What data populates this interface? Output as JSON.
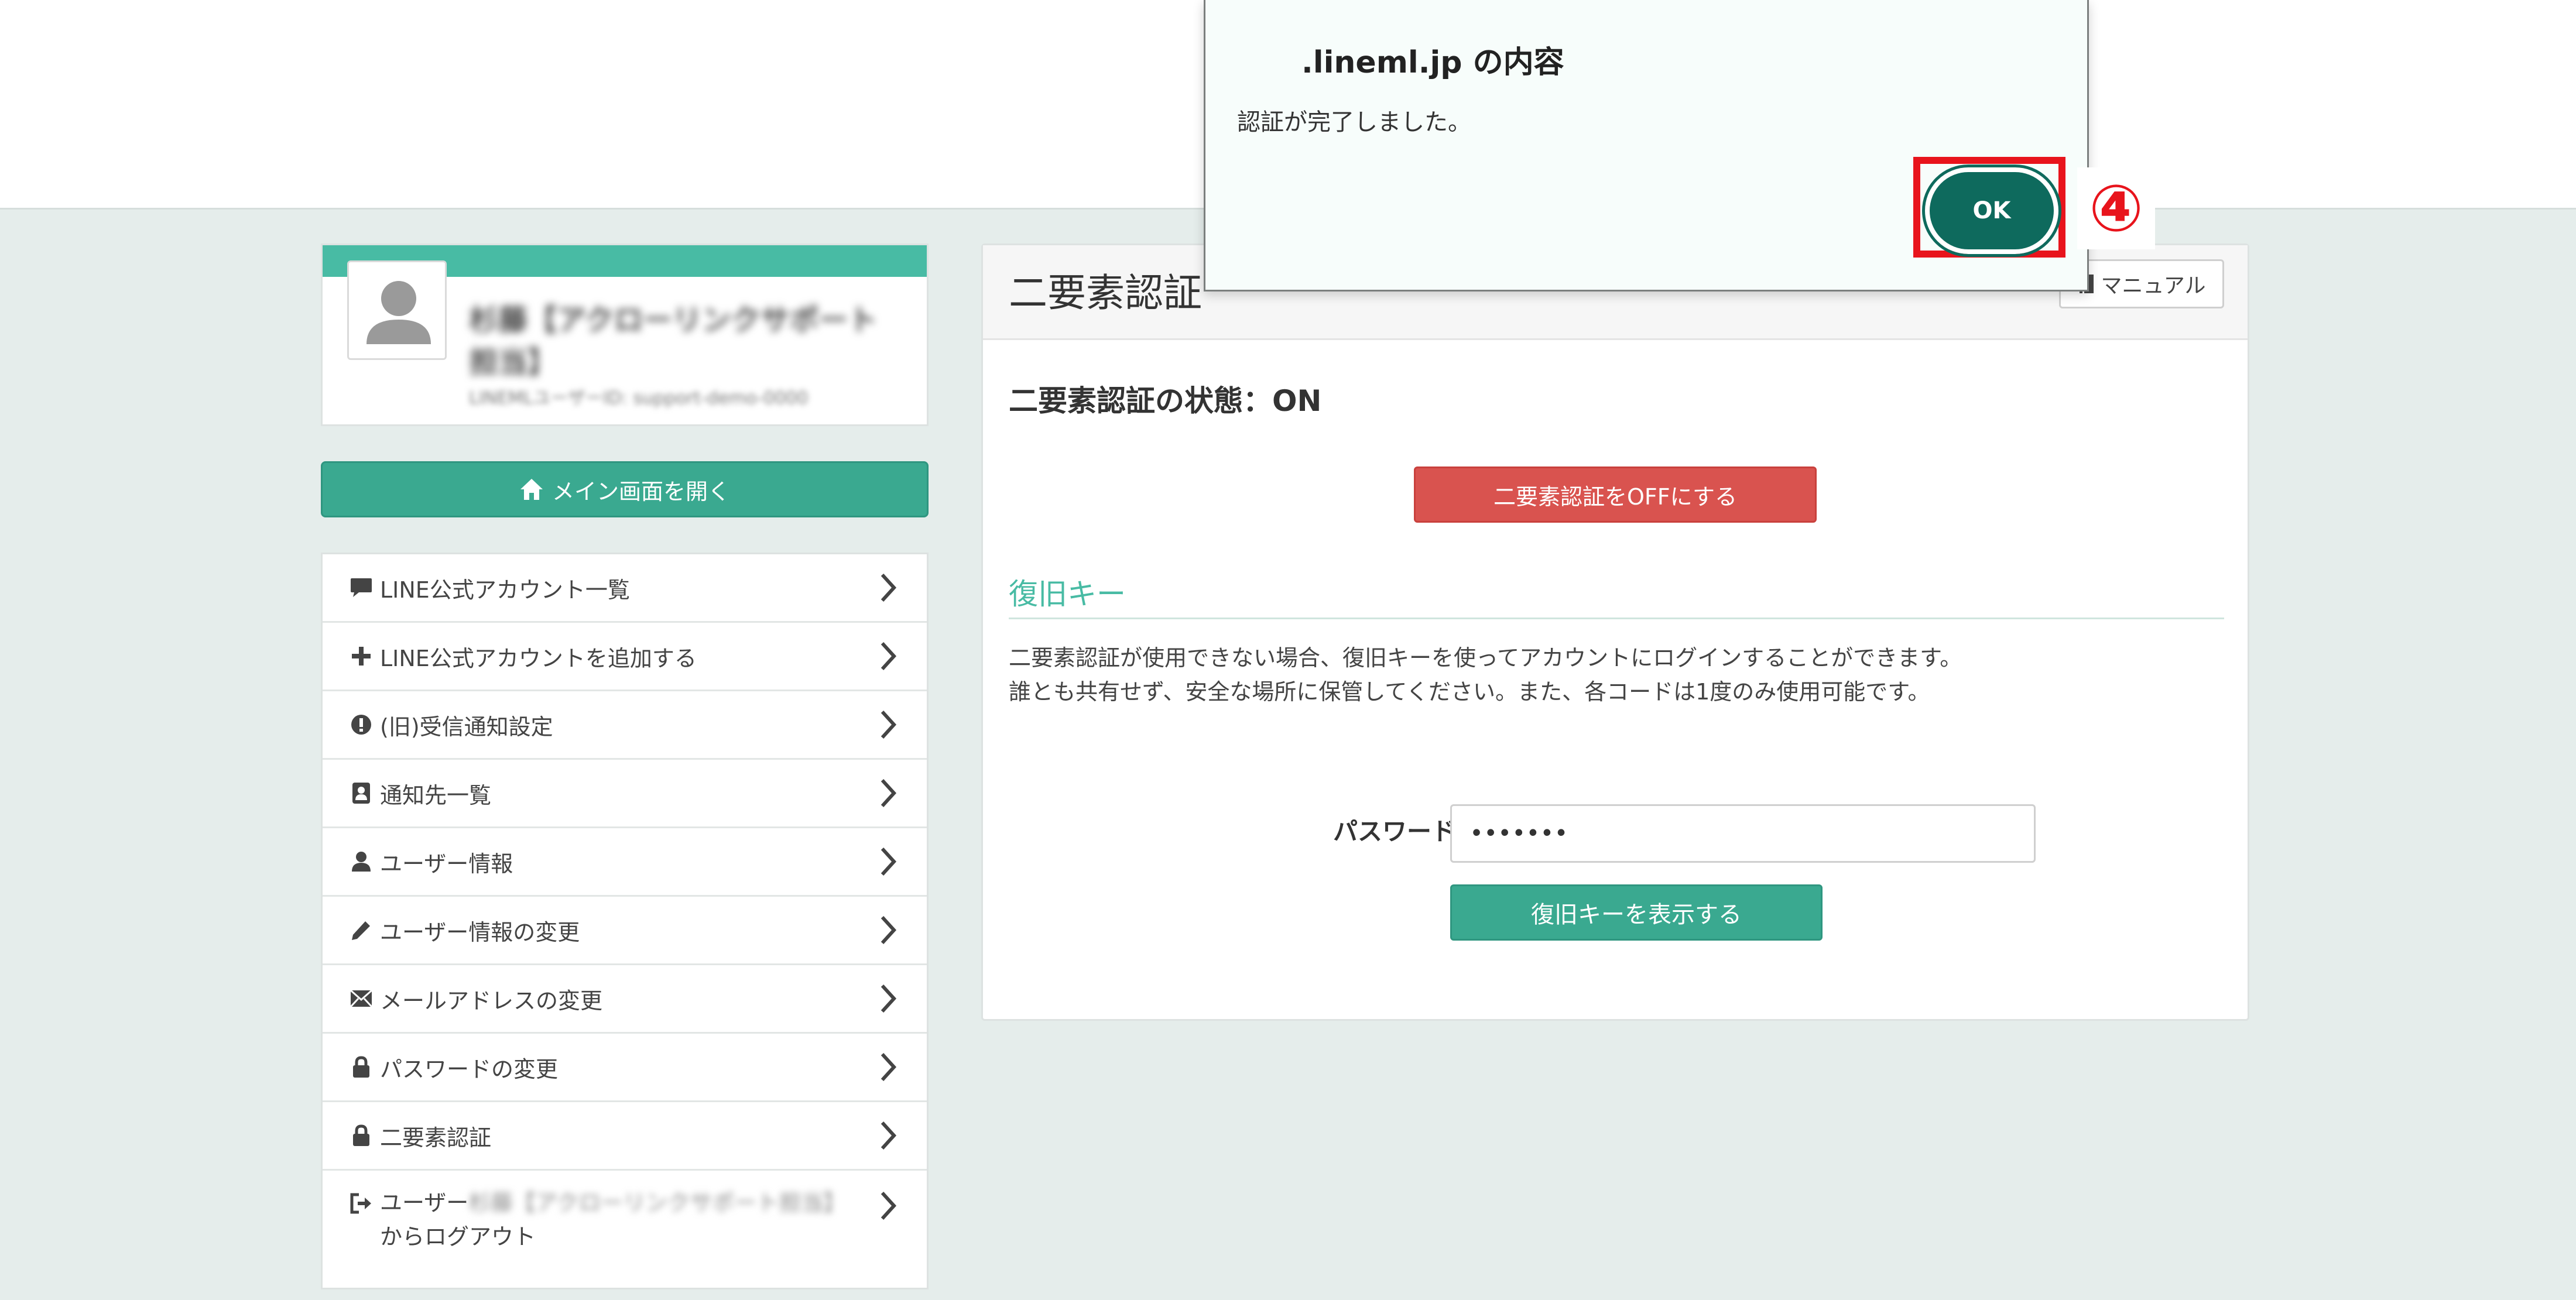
{
  "dialog": {
    "title": ".lineml.jp の内容",
    "message": "認証が完了しました。",
    "ok_label": "OK",
    "step_marker": "④"
  },
  "profile": {
    "name": "杉藤【アクローリンクサポート担当】",
    "sub": "LINEMLユーザーID: support-demo-0000"
  },
  "main_button": {
    "icon": "home-icon",
    "label": "メイン画面を開く"
  },
  "sidebar": {
    "items": [
      {
        "icon": "comment-icon",
        "label": "LINE公式アカウント一覧"
      },
      {
        "icon": "plus-icon",
        "label": "LINE公式アカウントを追加する"
      },
      {
        "icon": "exclamation-circle-icon",
        "label": "(旧)受信通知設定"
      },
      {
        "icon": "address-book-icon",
        "label": "通知先一覧"
      },
      {
        "icon": "user-icon",
        "label": "ユーザー情報"
      },
      {
        "icon": "pencil-icon",
        "label": "ユーザー情報の変更"
      },
      {
        "icon": "envelope-icon",
        "label": "メールアドレスの変更"
      },
      {
        "icon": "lock-icon",
        "label": "パスワードの変更"
      },
      {
        "icon": "lock-icon",
        "label": "二要素認証"
      }
    ],
    "logout": {
      "icon": "sign-out-icon",
      "prefix": "ユーザー",
      "user": "杉藤【アクローリンクサポート担当】",
      "suffix": "からログアウト"
    }
  },
  "panel": {
    "title": "二要素認証",
    "manual_label": "マニュアル",
    "status": "二要素認証の状態：ON",
    "off_button": "二要素認証をOFFにする",
    "recovery_title": "復旧キー",
    "desc_line1": "二要素認証が使用できない場合、復旧キーを使ってアカウントにログインすることができます。",
    "desc_line2": "誰とも共有せず、安全な場所に保管してください。また、各コードは1度のみ使用可能です。",
    "password_label": "パスワード",
    "password_value": "•••••••",
    "show_button": "復旧キーを表示する"
  },
  "colors": {
    "accent": "#48bba4",
    "button_green": "#3aa990",
    "danger": "#d9534f",
    "ok_button": "#0e6a5d",
    "highlight_red": "#e8141c",
    "page_bg": "#e5edeb"
  }
}
